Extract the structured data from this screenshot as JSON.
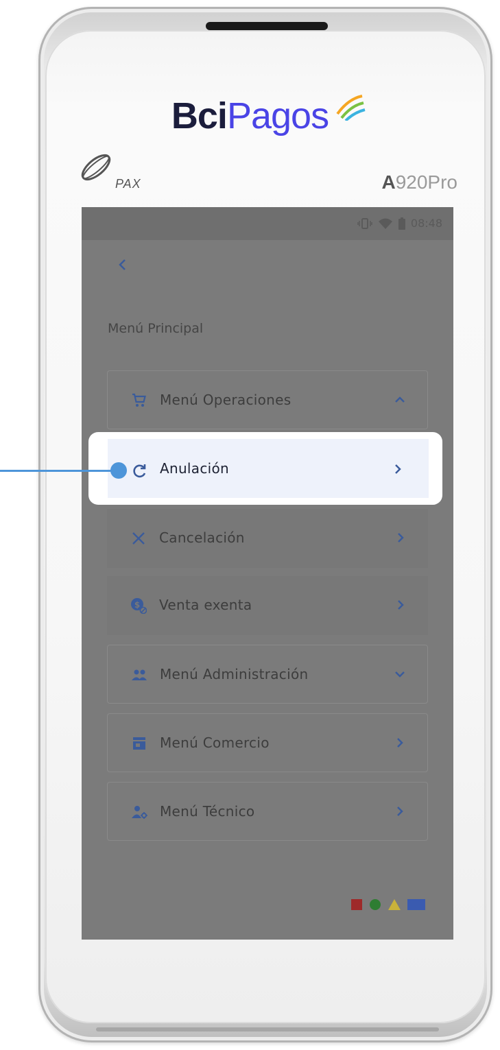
{
  "brand": {
    "bci": "Bci",
    "pagos": "Pagos"
  },
  "device": {
    "maker": "PAX",
    "model_bold": "A",
    "model_rest": "920Pro"
  },
  "statusbar": {
    "time": "08:48",
    "icons": [
      "vibrate-icon",
      "wifi-icon",
      "battery-icon"
    ]
  },
  "screen": {
    "back_icon": "chevron-left-icon",
    "title": "Menú Principal"
  },
  "menu": {
    "operaciones": {
      "label": "Menú Operaciones",
      "icon": "cart-icon",
      "state": "expanded"
    },
    "anulacion": {
      "label": "Anulación",
      "icon": "refresh-icon"
    },
    "cancelacion": {
      "label": "Cancelación",
      "icon": "close-icon"
    },
    "venta_exenta": {
      "label": "Venta exenta",
      "icon": "exempt-coin-icon"
    },
    "administracion": {
      "label": "Menú Administración",
      "icon": "group-icon",
      "state": "collapsed"
    },
    "comercio": {
      "label": "Menú Comercio",
      "icon": "store-icon"
    },
    "tecnico": {
      "label": "Menú Técnico",
      "icon": "user-gear-icon"
    }
  },
  "colors": {
    "accent_blue": "#3a5b9b",
    "callout_blue": "#4d95d9",
    "brand_navy": "#1b1d3c",
    "brand_purple": "#4a44e6",
    "shape_red": "#9e2a2a",
    "shape_green": "#2e7d32",
    "shape_yellow": "#c9b23a",
    "shape_blue": "#3a5bb0"
  }
}
